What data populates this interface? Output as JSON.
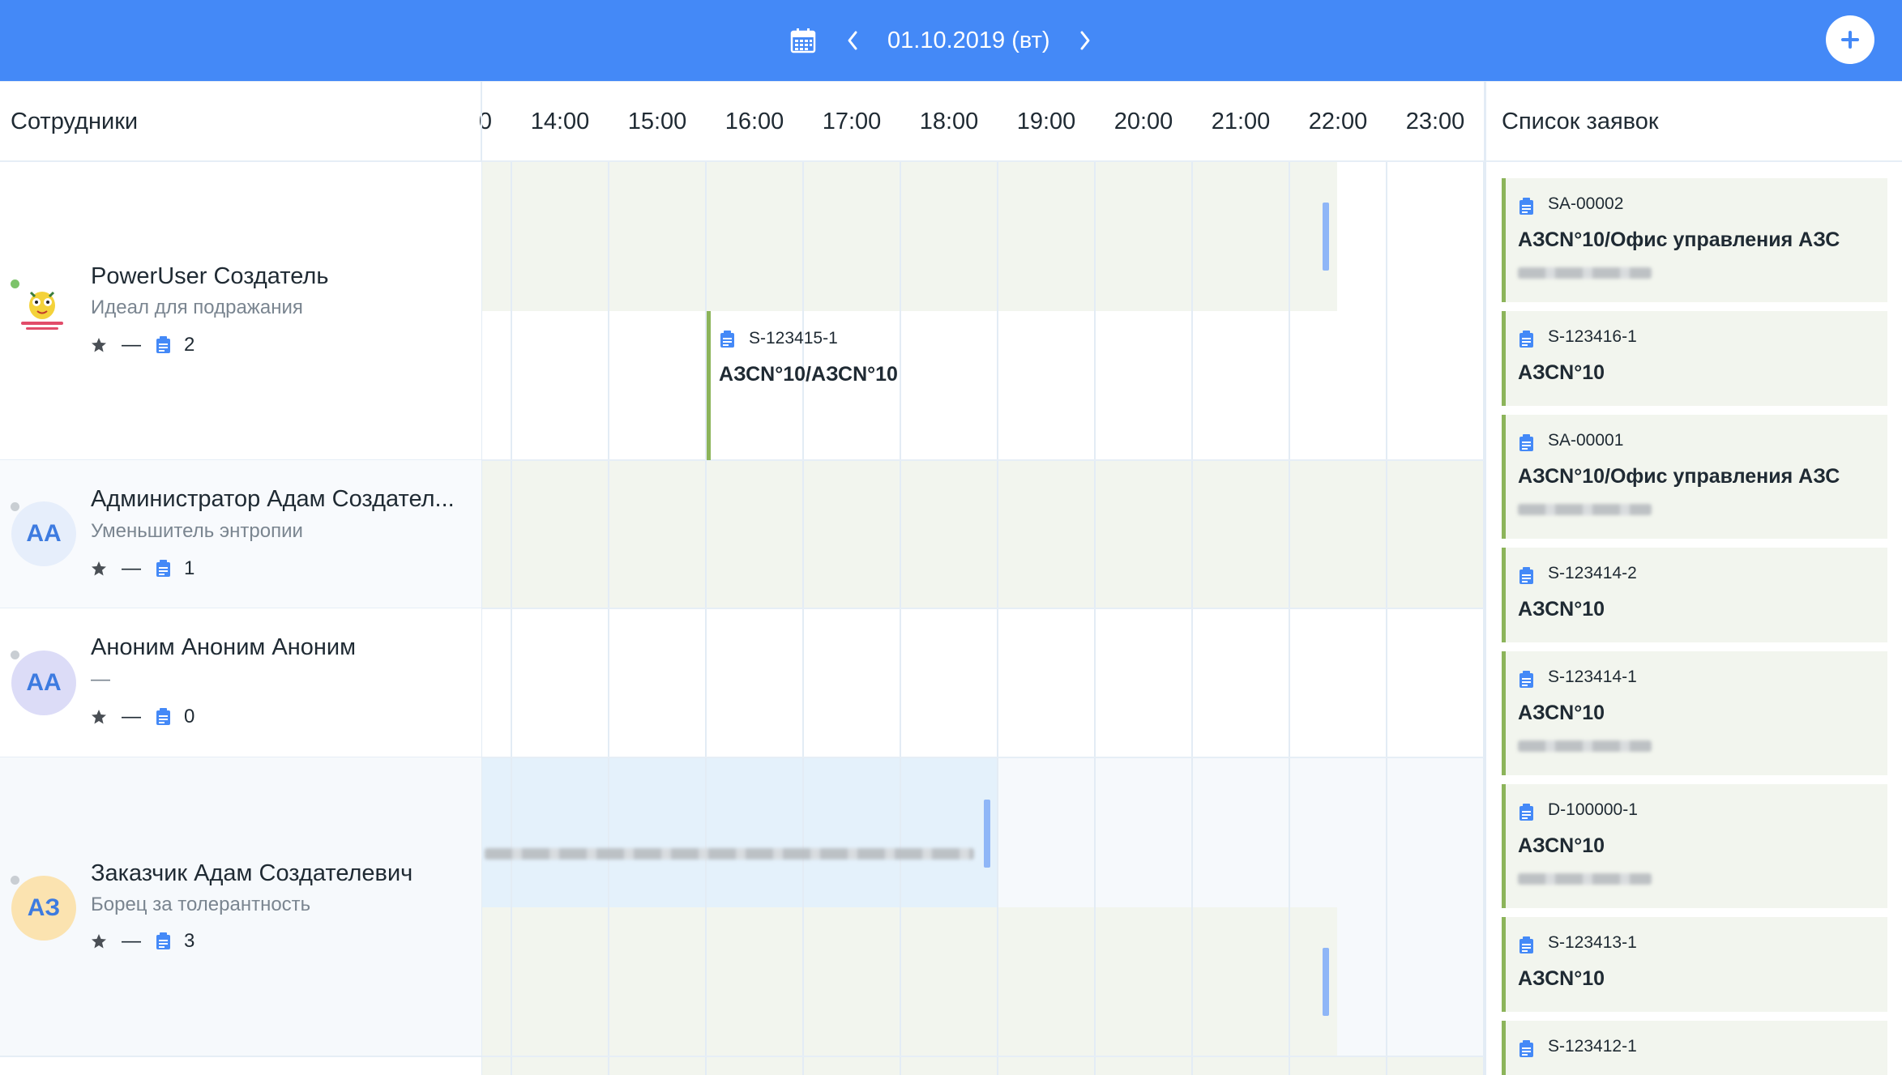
{
  "topbar": {
    "date": "01.10.2019 (вт)",
    "calendar_icon": "calendar-icon",
    "prev_icon": "chevron-left-icon",
    "next_icon": "chevron-right-icon",
    "add_icon": "plus-icon",
    "accent_color": "#4489f7"
  },
  "header": {
    "employees_title": "Сотрудники",
    "requests_title": "Список заявок",
    "hours": [
      "0",
      "14:00",
      "15:00",
      "16:00",
      "17:00",
      "18:00",
      "19:00",
      "20:00",
      "21:00",
      "22:00",
      "23:00"
    ]
  },
  "employees": [
    {
      "name": "PowerUser Создатель",
      "role": "Идеал для подражания",
      "rating": "—",
      "tasks": "2",
      "online": true,
      "avatar": "image"
    },
    {
      "name": "Администратор Адам Создател...",
      "role": "Уменьшитель энтропии",
      "rating": "—",
      "tasks": "1",
      "online": false,
      "avatar": "АА"
    },
    {
      "name": "Аноним Аноним Аноним",
      "role": "—",
      "rating": "—",
      "tasks": "0",
      "online": false,
      "avatar": "АА"
    },
    {
      "name": "Заказчик Адам Создателевич",
      "role": "Борец за толерантность",
      "rating": "—",
      "tasks": "3",
      "online": false,
      "avatar": "АЗ"
    }
  ],
  "schedule_tasks": [
    {
      "code": "S-123415-1",
      "title": "АЗСN°10/АЗСN°10"
    }
  ],
  "requests": [
    {
      "code": "SA-00002",
      "title": "АЗСN°10/Офис управления АЗС",
      "has_sub": true
    },
    {
      "code": "S-123416-1",
      "title": "АЗСN°10",
      "has_sub": false
    },
    {
      "code": "SA-00001",
      "title": "АЗСN°10/Офис управления АЗС",
      "has_sub": true
    },
    {
      "code": "S-123414-2",
      "title": "АЗСN°10",
      "has_sub": false
    },
    {
      "code": "S-123414-1",
      "title": "АЗСN°10",
      "has_sub": true
    },
    {
      "code": "D-100000-1",
      "title": "АЗСN°10",
      "has_sub": true
    },
    {
      "code": "S-123413-1",
      "title": "АЗСN°10",
      "has_sub": false
    },
    {
      "code": "S-123412-1",
      "title": "",
      "has_sub": false
    }
  ],
  "colors": {
    "busy_band": "#f2f5ee",
    "selected_band": "#e4f1fb",
    "request_border": "#8cb45a",
    "marker_blue": "#8fb6f7",
    "online_dot": "#7cc36a",
    "offline_dot": "#c9ced3"
  }
}
